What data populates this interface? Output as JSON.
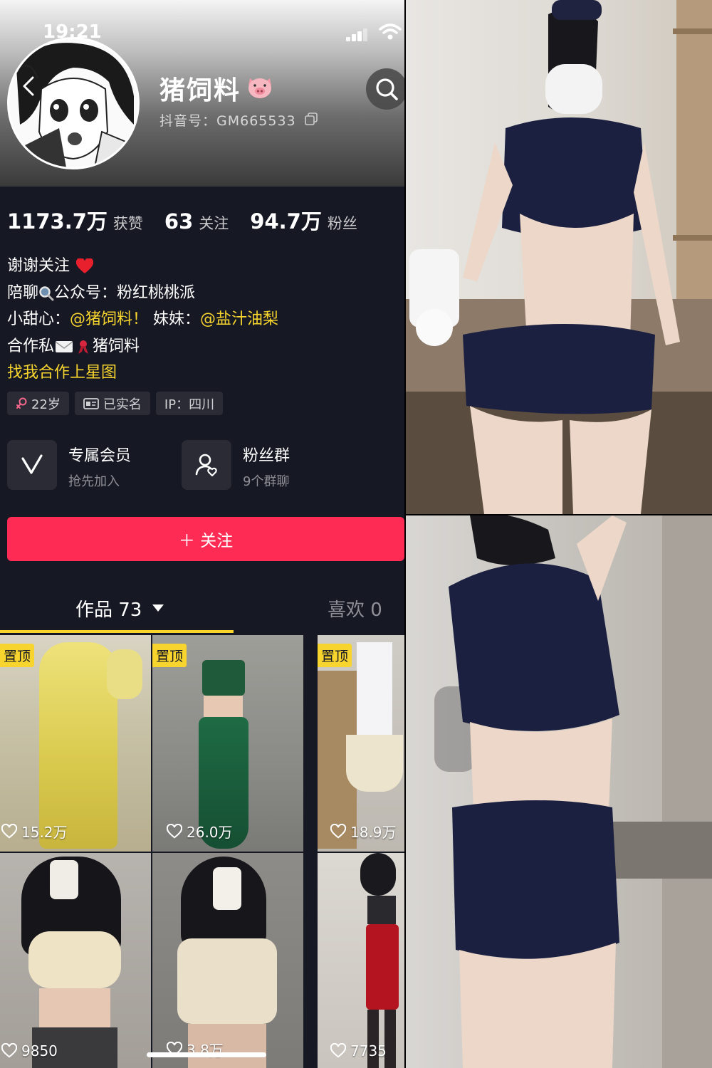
{
  "status_bar": {
    "time": "19:21"
  },
  "profile": {
    "nickname": "猪饲料",
    "nickname_emoji": "pig-face",
    "account_id": "抖音号：GM665533"
  },
  "stats": [
    {
      "value": "1173.7万",
      "label": "获赞"
    },
    {
      "value": "63",
      "label": "关注"
    },
    {
      "value": "94.7万",
      "label": "粉丝"
    }
  ],
  "bio": {
    "line1": "谢谢关注",
    "line2_a": "陪聊",
    "line2_b": "公众号：粉红桃桃派",
    "line3_a": "小甜心：",
    "line3_link1": "@猪饲料！",
    "line3_b": " 妹妹：",
    "line3_link2": "@盐汁油梨",
    "line4_a": "合作私",
    "line4_b": "猪饲料",
    "line5_link": "找我合作上星图"
  },
  "tags": [
    {
      "icon": "female-icon",
      "text": "22岁"
    },
    {
      "icon": "id-card-icon",
      "text": "已实名"
    },
    {
      "icon": "",
      "text": "IP：四川"
    }
  ],
  "features": [
    {
      "icon": "v-logo-icon",
      "title": "专属会员",
      "subtitle": "抢先加入"
    },
    {
      "icon": "group-icon",
      "title": "粉丝群",
      "subtitle": "9个群聊"
    }
  ],
  "follow_button": "＋ 关注",
  "tabs": {
    "works": "作品 73",
    "likes": "喜欢 0"
  },
  "videos": [
    {
      "pinned": "置顶",
      "likes": "15.2万"
    },
    {
      "pinned": "置顶",
      "likes": "26.0万"
    },
    {
      "pinned": "置顶",
      "likes": "18.9万"
    },
    {
      "pinned": "",
      "likes": "9850"
    },
    {
      "pinned": "",
      "likes": "3.8万"
    },
    {
      "pinned": "",
      "likes": "7735"
    }
  ],
  "colors": {
    "background": "#161823",
    "accent_red": "#fe2c55",
    "accent_yellow": "#f7d52e"
  }
}
